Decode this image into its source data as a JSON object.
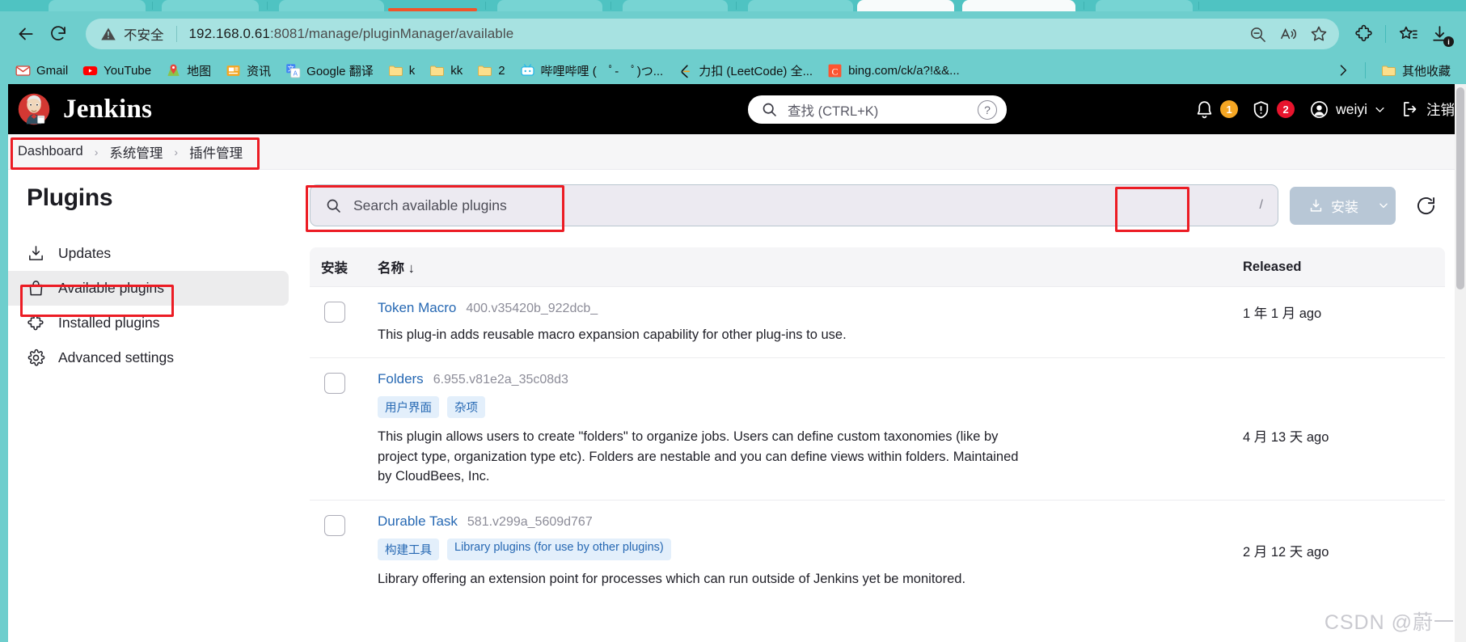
{
  "browser": {
    "security_label": "不安全",
    "url_host": "192.168.0.61",
    "url_path": ":8081/manage/pluginManager/available",
    "nav": {
      "back": "back-arrow",
      "reload": "reload"
    },
    "omnibox_icons": [
      "zoom-out-icon",
      "read-aloud-icon",
      "favorite-star-icon"
    ],
    "toolbar_icons": [
      "extensions-icon",
      "collections-icon",
      "downloads-icon"
    ],
    "bookmarks": [
      {
        "label": "Gmail",
        "icon": "gmail-icon"
      },
      {
        "label": "YouTube",
        "icon": "youtube-icon"
      },
      {
        "label": "地图",
        "icon": "maps-icon"
      },
      {
        "label": "资讯",
        "icon": "news-icon"
      },
      {
        "label": "Google 翻译",
        "icon": "google-translate-icon"
      },
      {
        "label": "k",
        "icon": "folder-icon"
      },
      {
        "label": "kk",
        "icon": "folder-icon"
      },
      {
        "label": "2",
        "icon": "folder-icon"
      },
      {
        "label": "哔哩哔哩 (　ﾟ-　ﾟ)つ...",
        "icon": "bilibili-icon"
      },
      {
        "label": "力扣 (LeetCode) 全...",
        "icon": "leetcode-icon"
      },
      {
        "label": "bing.com/ck/a?!&&...",
        "icon": "csdn-icon"
      }
    ],
    "bookmarks_overflow": "chevron-right-icon",
    "other_favorites": "其他收藏"
  },
  "jenkins": {
    "brand": "Jenkins",
    "search": {
      "placeholder": "查找 (CTRL+K)",
      "help": "?"
    },
    "notifications": {
      "icon": "bell-icon",
      "count": "1"
    },
    "security": {
      "icon": "shield-alert-icon",
      "count": "2"
    },
    "user": "weiyi",
    "logout": "注销",
    "breadcrumb": [
      "Dashboard",
      "系统管理",
      "插件管理"
    ],
    "breadcrumb_sep": "›"
  },
  "sidebar": {
    "title": "Plugins",
    "items": [
      {
        "label": "Updates",
        "icon": "download-icon",
        "active": false
      },
      {
        "label": "Available plugins",
        "icon": "shopping-bag-icon",
        "active": true
      },
      {
        "label": "Installed plugins",
        "icon": "puzzle-piece-icon",
        "active": false
      },
      {
        "label": "Advanced settings",
        "icon": "gear-icon",
        "active": false
      }
    ]
  },
  "main": {
    "search_placeholder": "Search available plugins",
    "search_shortcut": "/",
    "install_button": "安装",
    "install_caret": "chevron-down-icon",
    "refresh_icon": "refresh-icon",
    "table": {
      "headers": {
        "install": "安装",
        "name": "名称 ↓",
        "released": "Released"
      },
      "rows": [
        {
          "name": "Token Macro",
          "version": "400.v35420b_922dcb_",
          "labels": [],
          "description": "This plug-in adds reusable macro expansion capability for other plug-ins to use.",
          "released": "1 年 1 月 ago",
          "checked": false
        },
        {
          "name": "Folders",
          "version": "6.955.v81e2a_35c08d3",
          "labels": [
            "用户界面",
            "杂项"
          ],
          "description": "This plugin allows users to create \"folders\" to organize jobs. Users can define custom taxonomies (like by project type, organization type etc). Folders are nestable and you can define views within folders. Maintained by CloudBees, Inc.",
          "released": "4 月 13 天 ago",
          "checked": false
        },
        {
          "name": "Durable Task",
          "version": "581.v299a_5609d767",
          "labels": [
            "构建工具",
            "Library plugins (for use by other plugins)"
          ],
          "description": "Library offering an extension point for processes which can run outside of Jenkins yet be monitored.",
          "released": "2 月 12 天 ago",
          "checked": false
        }
      ]
    }
  },
  "watermark": "CSDN @蔚一",
  "colors": {
    "browser_chrome": "#6ececd",
    "jenkins_header": "#000000",
    "link_blue": "#2668b3",
    "annotation_red": "#ec1c24",
    "badge_orange": "#f5a623",
    "badge_red": "#e8142d"
  }
}
